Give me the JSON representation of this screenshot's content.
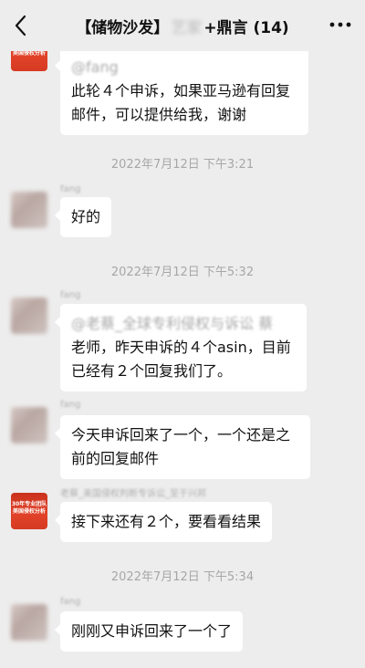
{
  "header": {
    "title_prefix": "【储物沙发】",
    "title_blurred": "艺家",
    "title_suffix": "+鼎言 (14)"
  },
  "icons": {
    "back": "chevron-left-icon",
    "more": "more-dots-icon"
  },
  "avatar_text": {
    "line1": "30年专业团队",
    "line2": "美国侵权分析"
  },
  "messages": [
    {
      "mention": "@fang",
      "text": "此轮４个申诉，如果亚马逊有回复邮件，可以提供给我，谢谢"
    },
    {
      "sender": "fang",
      "text": "好的"
    },
    {
      "sender": "fang",
      "mention": "@老蔡_全球专利侵权与诉讼 蔡",
      "text": "老师，昨天申诉的４个asin，目前已经有２个回复我们了。"
    },
    {
      "sender": "fang",
      "text": "今天申诉回来了一个，一个还是之前的回复邮件"
    },
    {
      "sender": "老蔡_美国侵权判断专诉讼_至于兴邦",
      "text": "接下来还有２个，要看看结果"
    },
    {
      "sender": "fang",
      "text": "刚刚又申诉回来了一个了"
    }
  ],
  "timestamps": [
    "2022年7月12日 下午3:21",
    "2022年7月12日 下午5:32",
    "2022年7月12日 下午5:34"
  ]
}
